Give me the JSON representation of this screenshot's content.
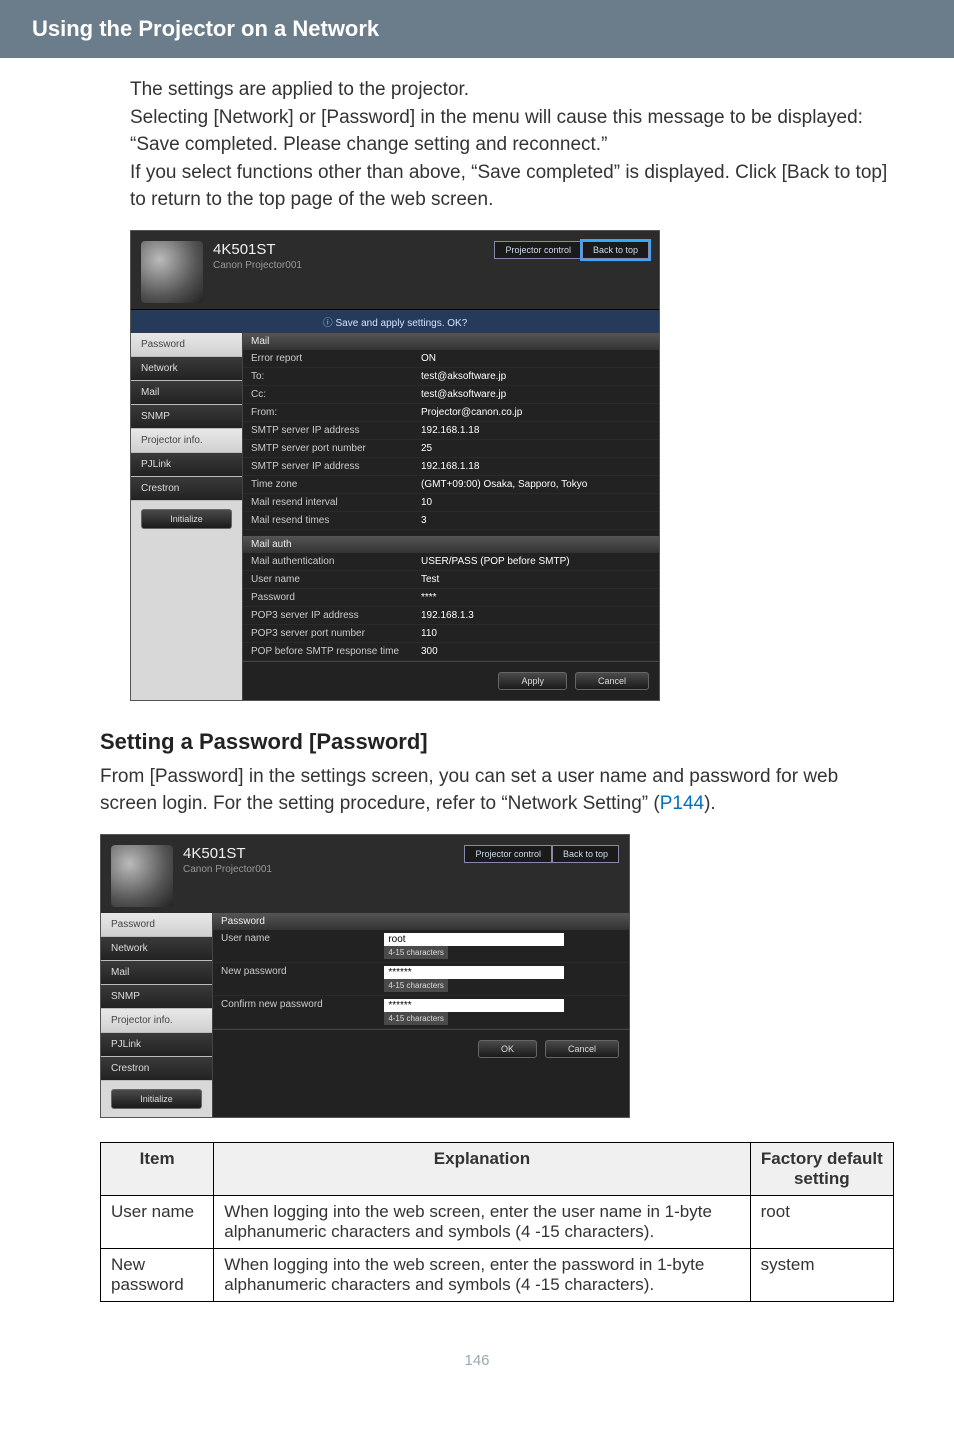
{
  "header": {
    "section_title": "Using the Projector on a Network"
  },
  "intro": {
    "p1": "The settings are applied to the projector.",
    "p2": "Selecting [Network] or [Password] in the menu will cause this message to be displayed: “Save completed. Please change setting and reconnect.”",
    "p3": "If you select functions other than above, “Save completed” is displayed. Click [Back to top] to return to the top page of the web screen."
  },
  "ui1": {
    "model": "4K501ST",
    "subtitle": "Canon Projector001",
    "btn_control": "Projector control",
    "btn_back": "Back to top",
    "banner": "Save and apply settings. OK?",
    "sidebar": [
      "Password",
      "Network",
      "Mail",
      "SNMP",
      "Projector info.",
      "PJLink",
      "Crestron"
    ],
    "side_action": "Initialize",
    "panels": [
      {
        "title": "Mail",
        "rows": [
          {
            "lbl": "Error report",
            "val": "ON"
          },
          {
            "lbl": "To:",
            "val": "test@aksoftware.jp"
          },
          {
            "lbl": "Cc:",
            "val": "test@aksoftware.jp"
          },
          {
            "lbl": "From:",
            "val": "Projector@canon.co.jp"
          },
          {
            "lbl": "SMTP server IP address",
            "val": "192.168.1.18"
          },
          {
            "lbl": "SMTP server port number",
            "val": "25"
          },
          {
            "lbl": "SMTP server IP address",
            "val": "192.168.1.18"
          },
          {
            "lbl": "Time zone",
            "val": "(GMT+09:00) Osaka, Sapporo, Tokyo"
          },
          {
            "lbl": "Mail resend interval",
            "val": "10"
          },
          {
            "lbl": "Mail resend times",
            "val": "3"
          }
        ]
      },
      {
        "title": "Mail auth",
        "rows": [
          {
            "lbl": "Mail authentication",
            "val": "USER/PASS (POP before SMTP)"
          },
          {
            "lbl": "User name",
            "val": "Test"
          },
          {
            "lbl": "Password",
            "val": "****"
          },
          {
            "lbl": "POP3 server IP address",
            "val": "192.168.1.3"
          },
          {
            "lbl": "POP3 server port number",
            "val": "110"
          },
          {
            "lbl": "POP before SMTP response time",
            "val": "300"
          }
        ]
      }
    ],
    "footer": [
      "Apply",
      "Cancel"
    ]
  },
  "section2": {
    "heading": "Setting a Password [Password]",
    "p1a": "From [Password] in the settings screen, you can set a user name and password for web screen login. For the setting procedure, refer to “Network Setting” (",
    "link": "P144",
    "p1b": ")."
  },
  "ui2": {
    "model": "4K501ST",
    "subtitle": "Canon Projector001",
    "btn_control": "Projector control",
    "btn_back": "Back to top",
    "sidebar": [
      "Password",
      "Network",
      "Mail",
      "SNMP",
      "Projector info.",
      "PJLink",
      "Crestron"
    ],
    "side_action": "Initialize",
    "panel_title": "Password",
    "rows": [
      {
        "lbl": "User name",
        "val": "root",
        "hint": "4-15\ncharacters"
      },
      {
        "lbl": "New password",
        "val": "******",
        "hint": "4-15\ncharacters"
      },
      {
        "lbl": "Confirm new password",
        "val": "******",
        "hint": "4-15\ncharacters"
      }
    ],
    "footer": [
      "OK",
      "Cancel"
    ]
  },
  "table": {
    "headers": [
      "Item",
      "Explanation",
      "Factory default setting"
    ],
    "rows": [
      {
        "item": "User name",
        "exp": "When logging into the web screen, enter the user name in 1-byte alphanumeric characters and symbols (4 -15 characters).",
        "def": "root"
      },
      {
        "item": "New password",
        "exp": "When logging into the web screen, enter the password in 1-byte alphanumeric characters and symbols (4 -15 characters).",
        "def": "system"
      }
    ]
  },
  "page_number": "146"
}
